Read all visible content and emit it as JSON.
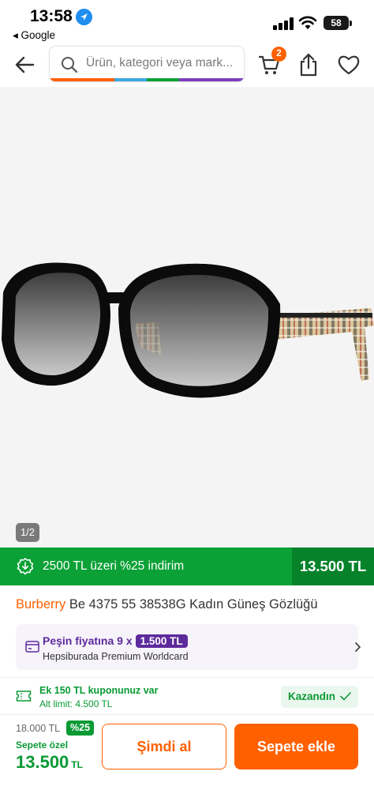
{
  "status_bar": {
    "time": "13:58",
    "back_app": "◂ Google",
    "battery": "58"
  },
  "header": {
    "search_placeholder": "Ürün, kategori veya mark...",
    "cart_count": "2",
    "stripe_colors": [
      "#ff6000",
      "#ff6000",
      "#3aa9df",
      "#0ba136",
      "#7b3fbd",
      "#7b3fbd"
    ]
  },
  "product_image": {
    "counter": "1/2"
  },
  "promo": {
    "text": "2500 TL üzeri %25 indirim",
    "price": "13.500 TL"
  },
  "product": {
    "brand": "Burberry",
    "name": " Be 4375 55 38538G Kadın Güneş Gözlüğü"
  },
  "worldcard": {
    "prefix": "Peşin fiyatına",
    "multiplier": "9 x",
    "installment": "1.500 TL",
    "card_name": "Hepsiburada Premium Worldcard"
  },
  "coupon": {
    "title": "Ek 150 TL kuponunuz var",
    "limit": "Alt limit: 4.500 TL",
    "earned_label": "Kazandın"
  },
  "pricing": {
    "old_price": "18.000 TL",
    "discount": "%25",
    "special_label": "Sepete özel",
    "special_price": "13.500",
    "currency": "TL"
  },
  "actions": {
    "buy_now": "Şimdi al",
    "add_to_cart": "Sepete ekle"
  },
  "colors": {
    "brand_orange": "#ff6000",
    "promo_green": "#0ba136",
    "purple": "#5d2a9b"
  }
}
